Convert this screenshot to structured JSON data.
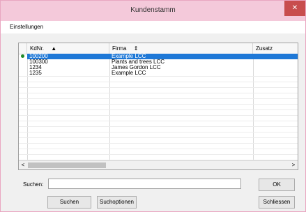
{
  "window": {
    "title": "Kundenstamm",
    "close_glyph": "✕"
  },
  "menu": {
    "items": [
      "Einstellungen"
    ]
  },
  "grid": {
    "columns": [
      "KdNr.",
      "Firma",
      "Zusatz"
    ],
    "sort_glyphs": [
      "▲",
      "⇕"
    ],
    "rows": [
      {
        "kdnr": "100200",
        "firma": "Example LCC",
        "zusatz": "",
        "selected": true,
        "marker": true
      },
      {
        "kdnr": "100300",
        "firma": "Plants and trees LCC",
        "zusatz": ""
      },
      {
        "kdnr": "1234",
        "firma": "James Gordon LCC",
        "zusatz": ""
      },
      {
        "kdnr": "1235",
        "firma": "Example LCC",
        "zusatz": ""
      }
    ],
    "scroll_left": "<",
    "scroll_right": ">"
  },
  "search": {
    "label": "Suchen:",
    "value": ""
  },
  "buttons": {
    "ok": "OK",
    "suchen": "Suchen",
    "suchoptionen": "Suchoptionen",
    "schliessen": "Schliessen"
  },
  "colors": {
    "selection": "#1e78d7",
    "titlebar": "#f4c9da",
    "close": "#c84d4d",
    "marker": "#1f8a2a"
  }
}
